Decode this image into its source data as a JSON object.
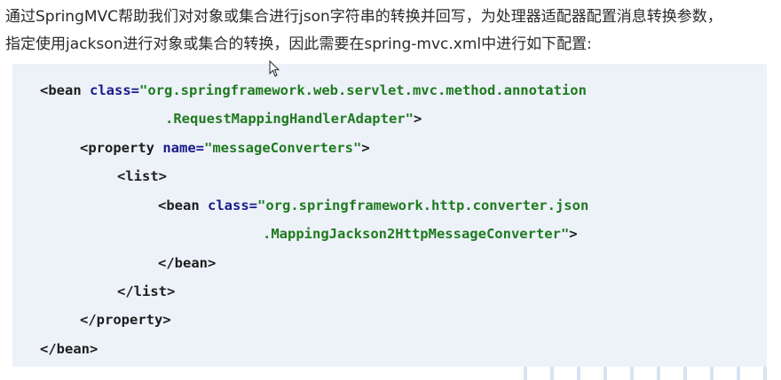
{
  "intro": {
    "line1": "通过SpringMVC帮助我们对对象或集合进行json字符串的转换并回写，为处理器适配器配置消息转换参数，",
    "line2": "指定使用jackson进行对象或集合的转换，因此需要在spring-mvc.xml中进行如下配置:"
  },
  "code": {
    "l1_tag": "<bean",
    "l1_attr": "class=",
    "l1_str": "\"org.springframework.web.servlet.mvc.method.annotation",
    "l2_str": ".RequestMappingHandlerAdapter\"",
    "l2_tag": ">",
    "l3_tag": "<property",
    "l3_attr": "name=",
    "l3_str": "\"messageConverters\"",
    "l3_end": ">",
    "l4_tag": "<list>",
    "l5_tag": "<bean",
    "l5_attr": "class=",
    "l5_str": "\"org.springframework.http.converter.json",
    "l6_str": ".MappingJackson2HttpMessageConverter\"",
    "l6_tag": ">",
    "l7_tag": "</bean>",
    "l8_tag": "</list>",
    "l9_tag": "</property>",
    "l10_tag": "</bean>"
  },
  "colors": {
    "code_background": "#edf2f9",
    "attribute": "#1a1a8a",
    "string": "#1f7a1f"
  },
  "icons": {
    "cursor": "mouse-pointer-icon"
  }
}
